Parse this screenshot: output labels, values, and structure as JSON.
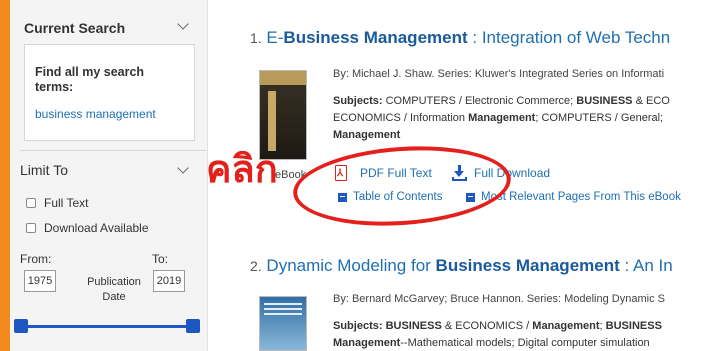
{
  "sidebar": {
    "current_search": {
      "heading": "Current Search",
      "find_label": "Find all my search terms:",
      "term": "business management"
    },
    "limit_to": {
      "heading": "Limit To",
      "options": [
        {
          "label": "Full Text",
          "checked": false
        },
        {
          "label": "Download Available",
          "checked": false
        }
      ],
      "from_label": "From:",
      "to_label": "To:",
      "from_value": "1975",
      "to_value": "2019",
      "publication_date_label": "Publication Date",
      "range_min_fraction": 0.0,
      "range_max_fraction": 1.0
    }
  },
  "results": [
    {
      "number": "1.",
      "title_parts": [
        "E-",
        "Business Management",
        " : Integration of Web Techn"
      ],
      "byline": "By: Michael J. Shaw. Series: Kluwer's Integrated Series on Informati",
      "subjects_label": "Subjects:",
      "subjects_lines": [
        [
          " COMPUTERS / Electronic Commerce; ",
          "BUSINESS",
          " & ECO"
        ],
        [
          "ECONOMICS / Information ",
          "Management",
          "; COMPUTERS / General; "
        ],
        [
          "",
          "Management",
          ""
        ]
      ],
      "type_label": "eBook",
      "links": {
        "pdf": "PDF Full Text",
        "download": "Full Download",
        "toc": "Table of Contents",
        "relevant": "Most Relevant Pages From This eBook"
      }
    },
    {
      "number": "2.",
      "title_parts": [
        "Dynamic Modeling for ",
        "Business Management",
        " : An In"
      ],
      "byline": "By: Bernard McGarvey; Bruce Hannon. Series: Modeling Dynamic S",
      "subjects_label": "Subjects:",
      "subjects_lines": [
        [
          " ",
          "BUSINESS",
          " & ECONOMICS / "
        ],
        [
          "Management",
          "--Mathematical models; Digital computer simulation",
          ""
        ]
      ],
      "subjects_line1_tail": [
        "Management",
        "; ",
        "BUSINESS"
      ]
    }
  ],
  "annotation": {
    "text": "คลิก",
    "color": "#e3201b"
  },
  "colors": {
    "accent_orange": "#f28a1e",
    "link_blue": "#1f6fb2",
    "slider_blue": "#1d57c2",
    "pdf_red": "#d9261c"
  }
}
